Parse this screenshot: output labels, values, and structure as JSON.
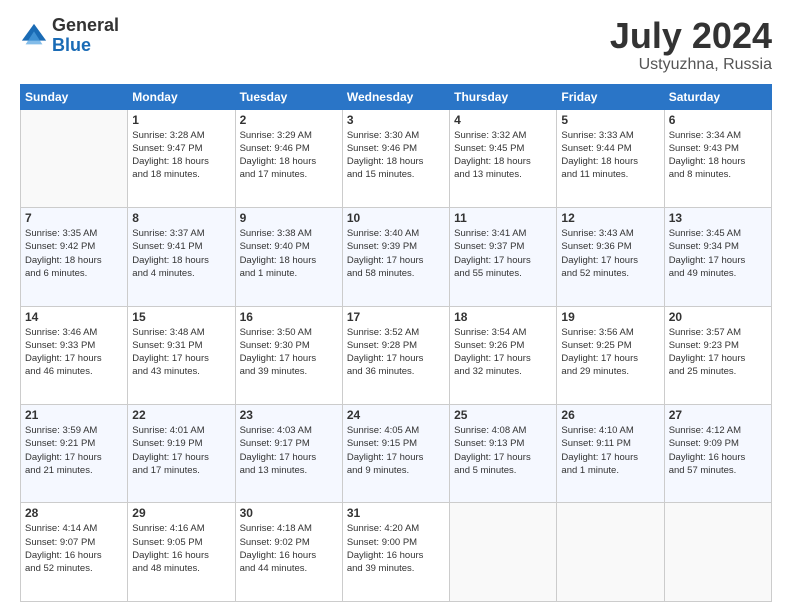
{
  "logo": {
    "general": "General",
    "blue": "Blue"
  },
  "title": {
    "month": "July 2024",
    "location": "Ustyuzhna, Russia"
  },
  "days_of_week": [
    "Sunday",
    "Monday",
    "Tuesday",
    "Wednesday",
    "Thursday",
    "Friday",
    "Saturday"
  ],
  "weeks": [
    [
      {
        "day": "",
        "info": ""
      },
      {
        "day": "1",
        "info": "Sunrise: 3:28 AM\nSunset: 9:47 PM\nDaylight: 18 hours\nand 18 minutes."
      },
      {
        "day": "2",
        "info": "Sunrise: 3:29 AM\nSunset: 9:46 PM\nDaylight: 18 hours\nand 17 minutes."
      },
      {
        "day": "3",
        "info": "Sunrise: 3:30 AM\nSunset: 9:46 PM\nDaylight: 18 hours\nand 15 minutes."
      },
      {
        "day": "4",
        "info": "Sunrise: 3:32 AM\nSunset: 9:45 PM\nDaylight: 18 hours\nand 13 minutes."
      },
      {
        "day": "5",
        "info": "Sunrise: 3:33 AM\nSunset: 9:44 PM\nDaylight: 18 hours\nand 11 minutes."
      },
      {
        "day": "6",
        "info": "Sunrise: 3:34 AM\nSunset: 9:43 PM\nDaylight: 18 hours\nand 8 minutes."
      }
    ],
    [
      {
        "day": "7",
        "info": "Sunrise: 3:35 AM\nSunset: 9:42 PM\nDaylight: 18 hours\nand 6 minutes."
      },
      {
        "day": "8",
        "info": "Sunrise: 3:37 AM\nSunset: 9:41 PM\nDaylight: 18 hours\nand 4 minutes."
      },
      {
        "day": "9",
        "info": "Sunrise: 3:38 AM\nSunset: 9:40 PM\nDaylight: 18 hours\nand 1 minute."
      },
      {
        "day": "10",
        "info": "Sunrise: 3:40 AM\nSunset: 9:39 PM\nDaylight: 17 hours\nand 58 minutes."
      },
      {
        "day": "11",
        "info": "Sunrise: 3:41 AM\nSunset: 9:37 PM\nDaylight: 17 hours\nand 55 minutes."
      },
      {
        "day": "12",
        "info": "Sunrise: 3:43 AM\nSunset: 9:36 PM\nDaylight: 17 hours\nand 52 minutes."
      },
      {
        "day": "13",
        "info": "Sunrise: 3:45 AM\nSunset: 9:34 PM\nDaylight: 17 hours\nand 49 minutes."
      }
    ],
    [
      {
        "day": "14",
        "info": "Sunrise: 3:46 AM\nSunset: 9:33 PM\nDaylight: 17 hours\nand 46 minutes."
      },
      {
        "day": "15",
        "info": "Sunrise: 3:48 AM\nSunset: 9:31 PM\nDaylight: 17 hours\nand 43 minutes."
      },
      {
        "day": "16",
        "info": "Sunrise: 3:50 AM\nSunset: 9:30 PM\nDaylight: 17 hours\nand 39 minutes."
      },
      {
        "day": "17",
        "info": "Sunrise: 3:52 AM\nSunset: 9:28 PM\nDaylight: 17 hours\nand 36 minutes."
      },
      {
        "day": "18",
        "info": "Sunrise: 3:54 AM\nSunset: 9:26 PM\nDaylight: 17 hours\nand 32 minutes."
      },
      {
        "day": "19",
        "info": "Sunrise: 3:56 AM\nSunset: 9:25 PM\nDaylight: 17 hours\nand 29 minutes."
      },
      {
        "day": "20",
        "info": "Sunrise: 3:57 AM\nSunset: 9:23 PM\nDaylight: 17 hours\nand 25 minutes."
      }
    ],
    [
      {
        "day": "21",
        "info": "Sunrise: 3:59 AM\nSunset: 9:21 PM\nDaylight: 17 hours\nand 21 minutes."
      },
      {
        "day": "22",
        "info": "Sunrise: 4:01 AM\nSunset: 9:19 PM\nDaylight: 17 hours\nand 17 minutes."
      },
      {
        "day": "23",
        "info": "Sunrise: 4:03 AM\nSunset: 9:17 PM\nDaylight: 17 hours\nand 13 minutes."
      },
      {
        "day": "24",
        "info": "Sunrise: 4:05 AM\nSunset: 9:15 PM\nDaylight: 17 hours\nand 9 minutes."
      },
      {
        "day": "25",
        "info": "Sunrise: 4:08 AM\nSunset: 9:13 PM\nDaylight: 17 hours\nand 5 minutes."
      },
      {
        "day": "26",
        "info": "Sunrise: 4:10 AM\nSunset: 9:11 PM\nDaylight: 17 hours\nand 1 minute."
      },
      {
        "day": "27",
        "info": "Sunrise: 4:12 AM\nSunset: 9:09 PM\nDaylight: 16 hours\nand 57 minutes."
      }
    ],
    [
      {
        "day": "28",
        "info": "Sunrise: 4:14 AM\nSunset: 9:07 PM\nDaylight: 16 hours\nand 52 minutes."
      },
      {
        "day": "29",
        "info": "Sunrise: 4:16 AM\nSunset: 9:05 PM\nDaylight: 16 hours\nand 48 minutes."
      },
      {
        "day": "30",
        "info": "Sunrise: 4:18 AM\nSunset: 9:02 PM\nDaylight: 16 hours\nand 44 minutes."
      },
      {
        "day": "31",
        "info": "Sunrise: 4:20 AM\nSunset: 9:00 PM\nDaylight: 16 hours\nand 39 minutes."
      },
      {
        "day": "",
        "info": ""
      },
      {
        "day": "",
        "info": ""
      },
      {
        "day": "",
        "info": ""
      }
    ]
  ]
}
